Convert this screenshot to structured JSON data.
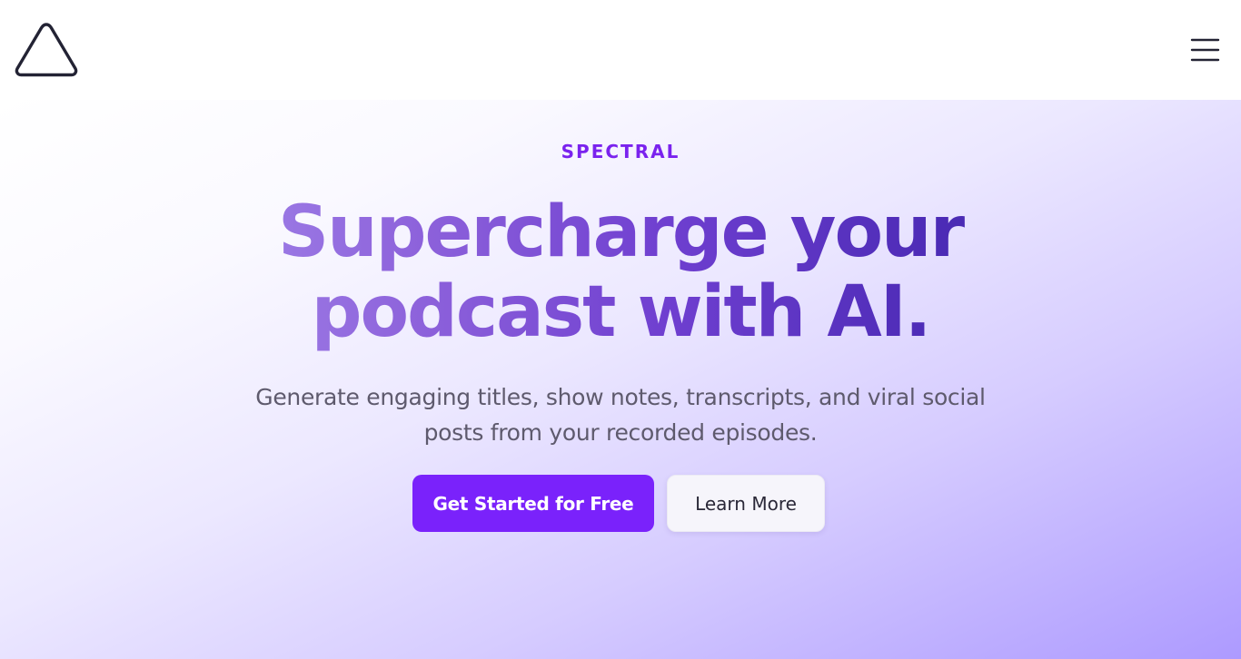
{
  "header": {
    "logo_icon": "triangle-logo-icon",
    "menu_icon": "hamburger-menu-icon"
  },
  "hero": {
    "eyebrow": "SPECTRAL",
    "headline_line1": "Supercharge your",
    "headline_line2": "podcast with AI.",
    "subtitle_line1": "Generate engaging titles, show notes, transcripts, and viral social",
    "subtitle_line2": "posts from your recorded episodes.",
    "primary_cta": "Get Started for Free",
    "secondary_cta": "Learn More"
  },
  "colors": {
    "accent": "#7a22fb",
    "eyebrow": "#7a22ee",
    "headline_start": "#a487ea",
    "headline_end": "#452aa9",
    "subtitle": "#5e5a6d",
    "icon": "#232334"
  }
}
